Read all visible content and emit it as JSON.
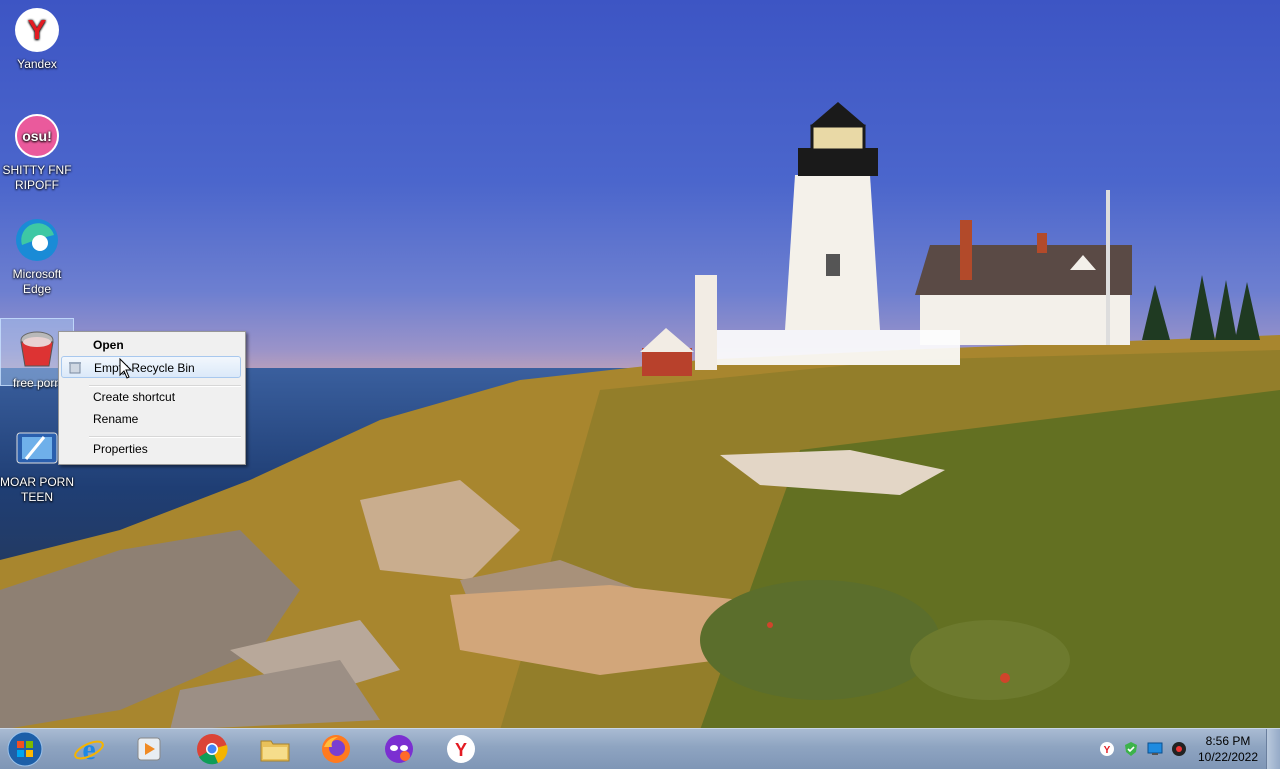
{
  "desktop": {
    "icons": [
      {
        "label": "Yandex"
      },
      {
        "label": "SHITTY FNF RIPOFF"
      },
      {
        "label": "Microsoft Edge"
      },
      {
        "label": "free porn"
      },
      {
        "label": "MOAR PORN TEEN"
      }
    ]
  },
  "context_menu": {
    "items": [
      {
        "label": "Open"
      },
      {
        "label": "Empty Recycle Bin"
      },
      {
        "label": "Create shortcut"
      },
      {
        "label": "Rename"
      },
      {
        "label": "Properties"
      }
    ]
  },
  "taskbar": {
    "apps": [
      "Internet Explorer",
      "Windows Media Player",
      "Google Chrome",
      "File Explorer",
      "Firefox",
      "Tor-like app",
      "Yandex"
    ],
    "clock": {
      "time": "8:56 PM",
      "date": "10/22/2022"
    }
  },
  "colors": {
    "taskbar": "#8ea4c1",
    "menu": "#f0f0f0",
    "hover": "#dbe9f9"
  }
}
